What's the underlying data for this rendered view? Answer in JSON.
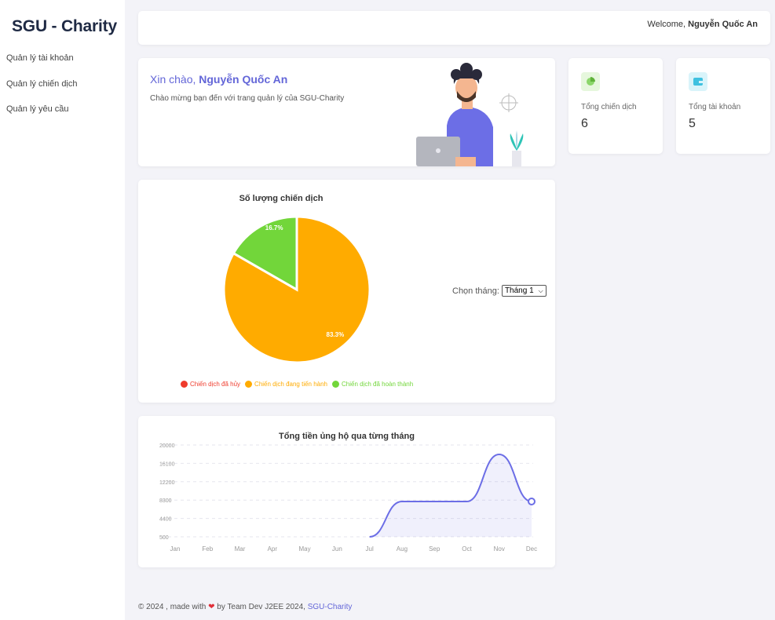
{
  "sidebar": {
    "brand": "SGU - Charity",
    "items": [
      {
        "label": "Quản lý tài khoản"
      },
      {
        "label": "Quản lý chiến dịch"
      },
      {
        "label": "Quản lý yêu cầu"
      }
    ]
  },
  "header": {
    "welcome_prefix": "Welcome, ",
    "user_name": "Nguyễn Quốc An"
  },
  "greeting": {
    "prefix": "Xin chào, ",
    "name": "Nguyễn Quốc An",
    "subtitle": "Chào mừng bạn đến với trang quản lý của SGU-Charity"
  },
  "stats": [
    {
      "label": "Tổng chiến dịch",
      "value": "6",
      "icon": "pie-chart-icon",
      "color": "#8bd66a",
      "bg": "#e6f7dd"
    },
    {
      "label": "Tổng tài khoản",
      "value": "5",
      "icon": "wallet-icon",
      "color": "#3ec1e0",
      "bg": "#d9f4fa"
    }
  ],
  "month_selector": {
    "label": "Chọn tháng:",
    "selected": "Tháng 1"
  },
  "chart_data": [
    {
      "type": "pie",
      "title": "Số lượng chiến dịch",
      "categories": [
        "Chiến dịch đã hủy",
        "Chiến dịch đang tiến hành",
        "Chiến dịch đã hoàn thành"
      ],
      "values": [
        0,
        83.3,
        16.7
      ],
      "labels": [
        "",
        "83.3%",
        "16.7%"
      ],
      "colors": [
        "#ef3b2c",
        "#ffab00",
        "#72d63a"
      ],
      "legend": "bottom"
    },
    {
      "type": "area",
      "title": "Tổng tiền ủng hộ qua từng tháng",
      "categories": [
        "Jan",
        "Feb",
        "Mar",
        "Apr",
        "May",
        "Jun",
        "Jul",
        "Aug",
        "Sep",
        "Oct",
        "Nov",
        "Dec"
      ],
      "values": [
        0,
        0,
        0,
        0,
        0,
        0,
        0,
        8000,
        8000,
        8000,
        18000,
        8000
      ],
      "yticks": [
        "20000",
        "16100",
        "12200",
        "8300",
        "4400",
        "500"
      ],
      "ylim": [
        500,
        20000
      ],
      "grid": true,
      "color": "#6c6ee6"
    }
  ],
  "footer": {
    "text": "© 2024 , made with ",
    "by": " by Team Dev J2EE 2024, ",
    "link": "SGU-Charity"
  }
}
